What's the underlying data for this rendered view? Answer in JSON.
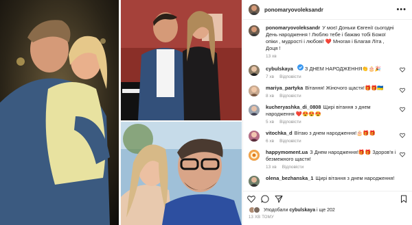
{
  "post": {
    "author": "ponomaryovoleksandr",
    "more_label": "•••",
    "caption": {
      "user": "ponomaryovoleksandr",
      "text": "У моєї Доньки Євгенії сьогодні День народження ! Люблю тебе і бажаю тобі Божої опіки , мудрості і любові! ❤️ Многая і Благая Літа , Доця !",
      "time": "13 хв"
    }
  },
  "comments": [
    {
      "user": "cybulskaya",
      "verified": true,
      "text": "З ДНЕМ НАРОДЖЕННЯ👏🎂🎉",
      "time": "7 хв",
      "likes": "",
      "reply": "Відповісти"
    },
    {
      "user": "mariya_partyka",
      "verified": false,
      "text": "Вітання! Жіночого щастя!🎁🎁🇺🇦",
      "time": "8 хв",
      "likes": "",
      "reply": "Відповісти"
    },
    {
      "user": "kucheryashka_di_0808",
      "verified": false,
      "text": "Щирі вітання з днем народження ❤️😍😍😍",
      "time": "5 хв",
      "likes": "",
      "reply": "Відповісти"
    },
    {
      "user": "vitochka_d",
      "verified": false,
      "text": "Вітаю з днем народження!🎂🎁🎁",
      "time": "6 хв",
      "likes": "",
      "reply": "Відповісти"
    },
    {
      "user": "happymoment.ua",
      "verified": false,
      "text": "З Днем народження!🎁🎁 Здоров'я і безмежного щастя!",
      "time": "13 хв",
      "likes": "",
      "reply": "Відповісти"
    },
    {
      "user": "olena_bezhanska_1",
      "verified": false,
      "text": "Щирі вітання з днем народження!",
      "time": "",
      "likes": "",
      "reply": ""
    }
  ],
  "likes": {
    "prefix": "Уподобали",
    "user": "cybulskaya",
    "suffix": "і ще 202"
  },
  "timestamp": "13 ХВ ТОМУ",
  "colors": {
    "verified": "#3897f0",
    "link": "#00376b",
    "muted": "#8e8e8e",
    "heart": "#262626"
  }
}
